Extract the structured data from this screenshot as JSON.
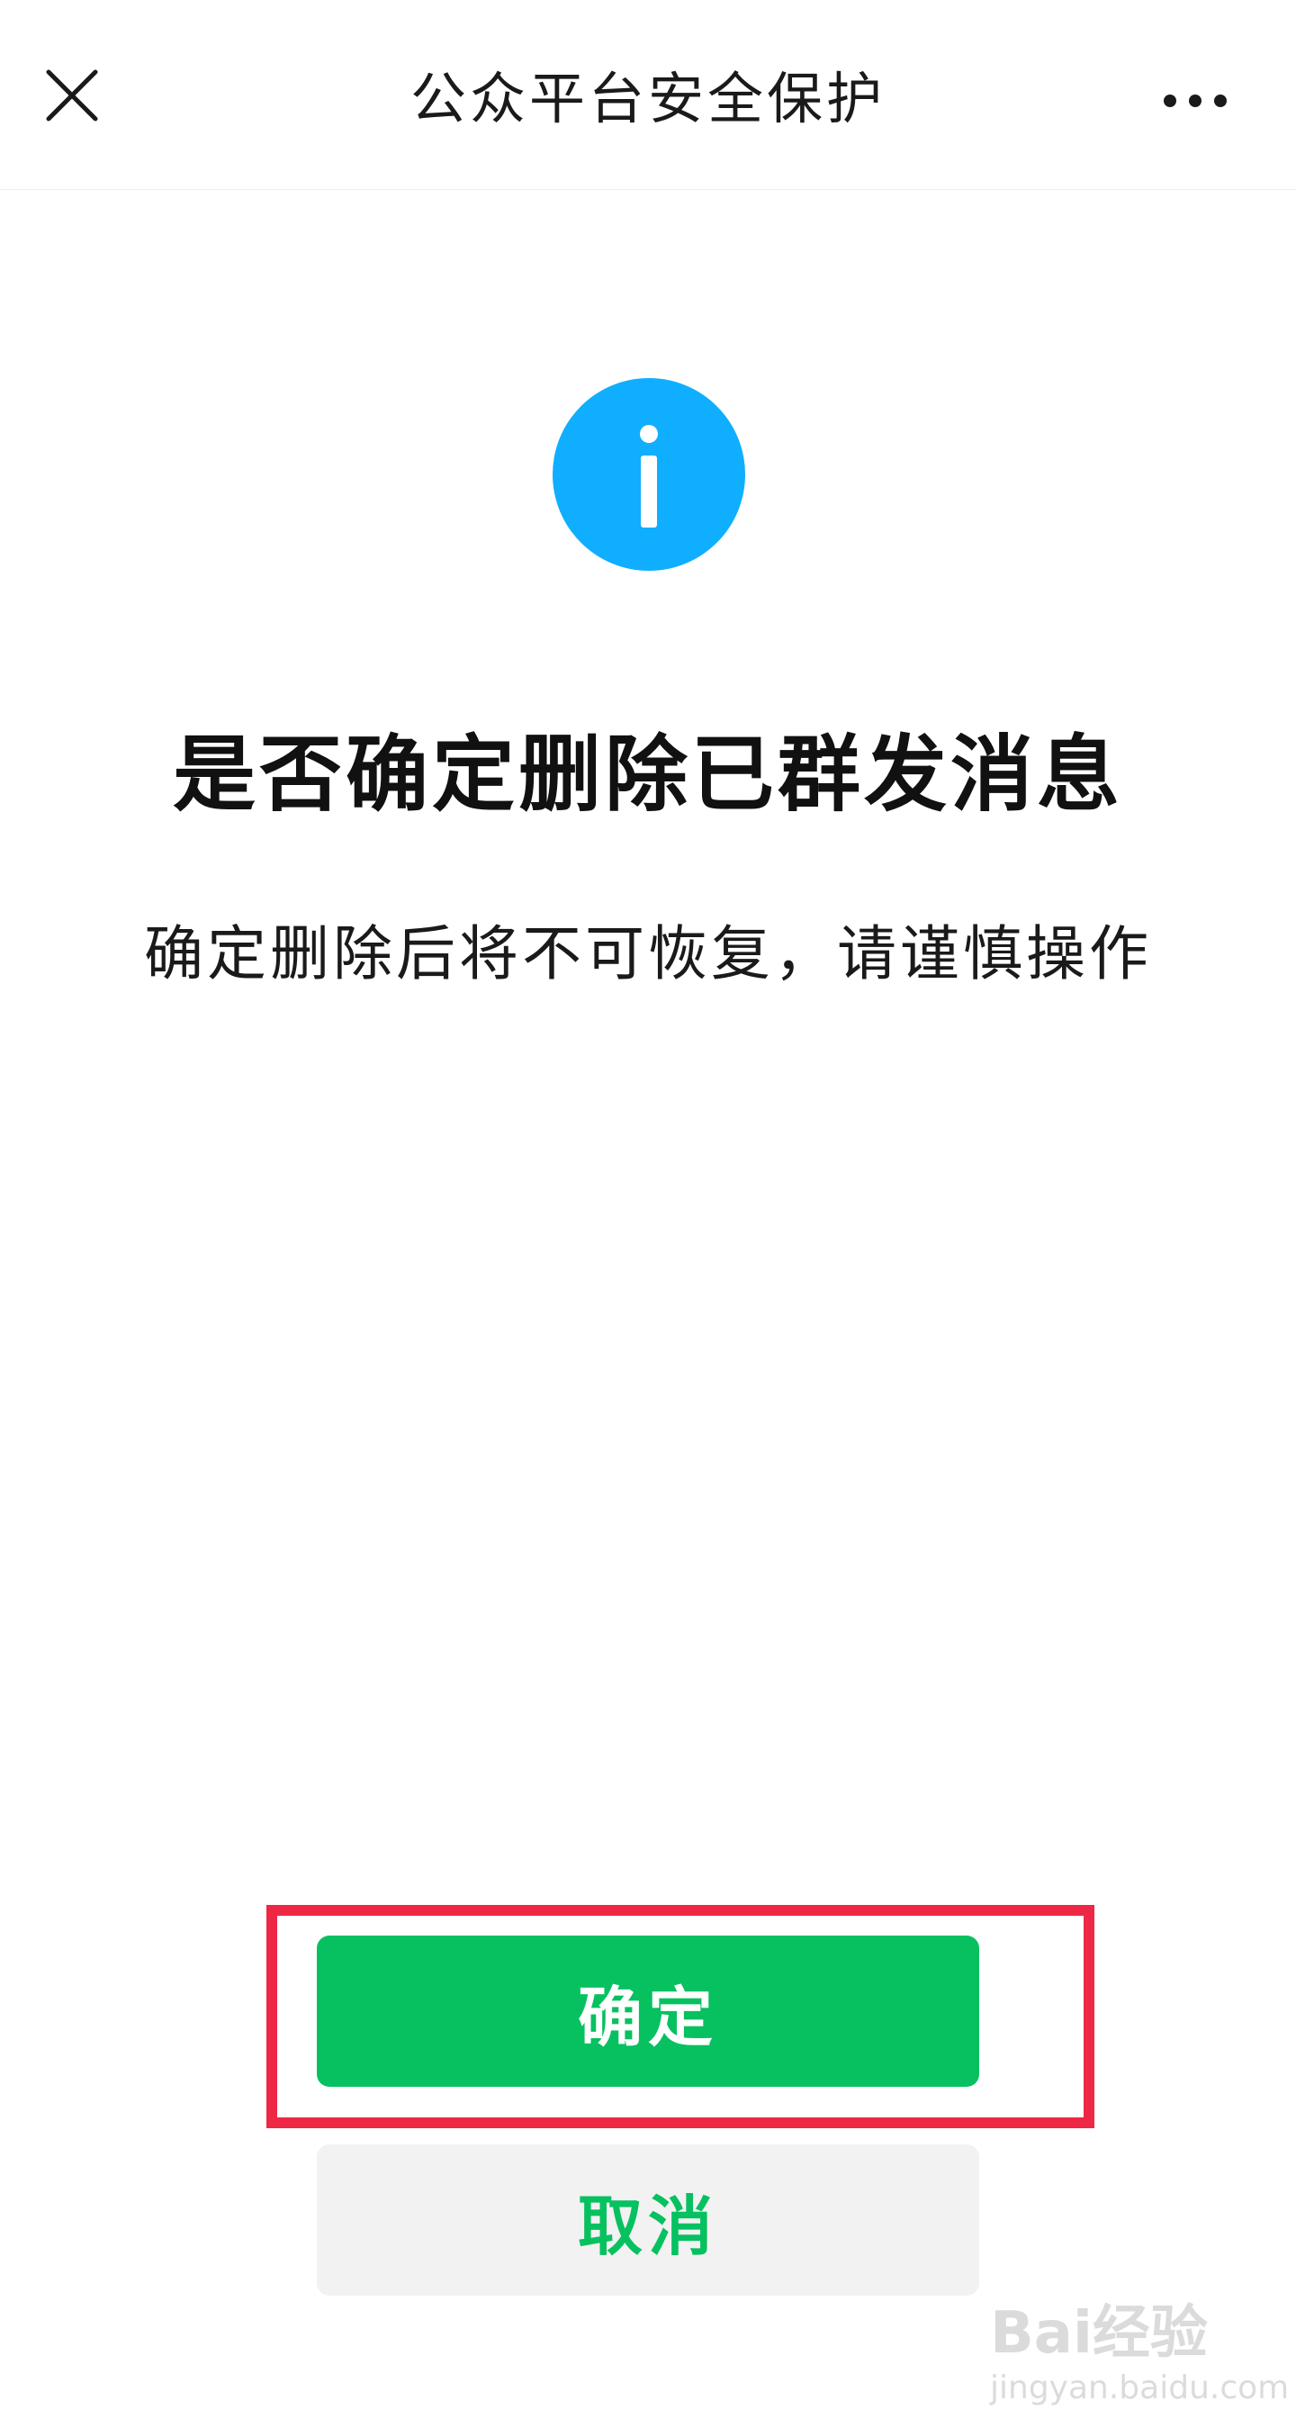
{
  "navbar": {
    "title": "公众平台安全保护",
    "close_icon": "close-icon",
    "more_icon": "more-dots-icon"
  },
  "dialog": {
    "icon": "info-icon",
    "title": "是否确定删除已群发消息",
    "subtitle": "确定删除后将不可恢复，请谨慎操作"
  },
  "buttons": {
    "confirm_label": "确定",
    "cancel_label": "取消"
  },
  "watermark": {
    "logo": "Bai经验",
    "url": "jingyan.baidu.com"
  },
  "colors": {
    "accent_green": "#07c160",
    "info_blue": "#10aeff",
    "highlight_red": "#ee2745",
    "cancel_bg": "#f2f2f2"
  }
}
